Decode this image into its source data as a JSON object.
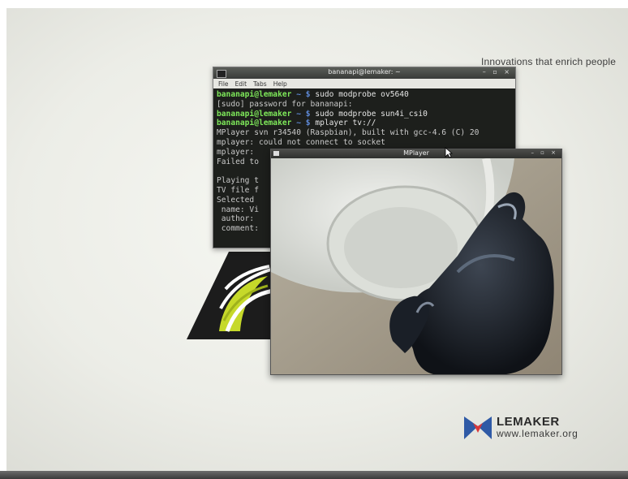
{
  "desktop": {
    "tagline": "Innovations that enrich people"
  },
  "terminal": {
    "title": "bananapi@lemaker: ~",
    "window_controls": "– ▫ ×",
    "menu": [
      "File",
      "Edit",
      "Tabs",
      "Help"
    ],
    "lines": [
      {
        "user": "bananapi@lemaker",
        "path": " ~ $ ",
        "text": "sudo modprobe ov5640"
      },
      {
        "user": "",
        "path": "",
        "text": "[sudo] password for bananapi:"
      },
      {
        "user": "bananapi@lemaker",
        "path": " ~ $ ",
        "text": "sudo modprobe sun4i_csi0"
      },
      {
        "user": "bananapi@lemaker",
        "path": " ~ $ ",
        "text": "mplayer tv://"
      },
      {
        "user": "",
        "path": "",
        "text": "MPlayer svn r34540 (Raspbian), built with gcc-4.6 (C) 20"
      },
      {
        "user": "",
        "path": "",
        "text": "mplayer: could not connect to socket"
      },
      {
        "user": "",
        "path": "",
        "text": "mplayer:"
      },
      {
        "user": "",
        "path": "",
        "text": "Failed to"
      },
      {
        "user": "",
        "path": "",
        "text": ""
      },
      {
        "user": "",
        "path": "",
        "text": "Playing t"
      },
      {
        "user": "",
        "path": "",
        "text": "TV file f"
      },
      {
        "user": "",
        "path": "",
        "text": "Selected"
      },
      {
        "user": "",
        "path": "",
        "text": " name: Vi"
      },
      {
        "user": "",
        "path": "",
        "text": " author:"
      },
      {
        "user": "",
        "path": "",
        "text": " comment:"
      }
    ]
  },
  "mplayer": {
    "title": "MPlayer",
    "window_controls": "– ▫ ×"
  },
  "lemaker": {
    "name": "LEMAKER",
    "url": "www.lemaker.org"
  },
  "colors": {
    "prompt_user": "#7ee85a",
    "prompt_path": "#5e89d6",
    "banana_yellow": "#c6d92a",
    "lemaker_blue": "#2f5aa6",
    "lemaker_red": "#d9383a"
  }
}
